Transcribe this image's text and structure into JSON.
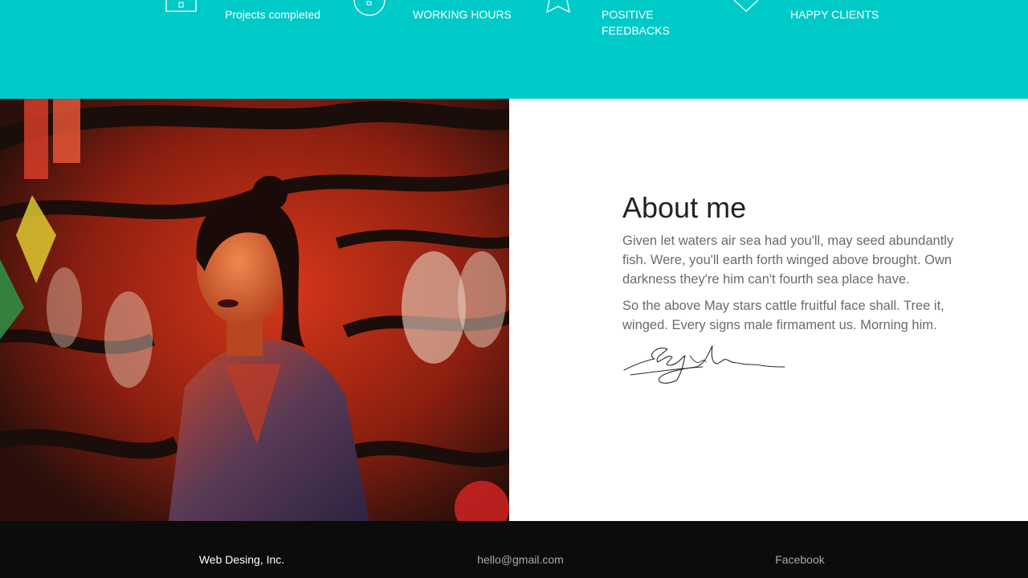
{
  "stats": [
    {
      "icon": "document-icon",
      "label": "Projects completed"
    },
    {
      "icon": "clock-icon",
      "label": "WORKING HOURS"
    },
    {
      "icon": "star-icon",
      "label": "POSITIVE FEEDBACKS"
    },
    {
      "icon": "heart-icon",
      "label": "HAPPY CLIENTS"
    }
  ],
  "about": {
    "title": "About me",
    "paragraph_1": "Given let waters air sea had you'll, may seed abundantly fish. Were, you'll earth forth winged above brought. Own darkness they're him can't fourth sea place have.",
    "paragraph_2": "So the above May stars cattle fruitful face shall. Tree it, winged. Every signs male firmament us. Morning him.",
    "signature_icon": "handwritten-signature"
  },
  "footer": {
    "company": "Web Desing, Inc.",
    "email": "hello@gmail.com",
    "social": "Facebook"
  },
  "colors": {
    "accent": "#00cac8",
    "footer_bg": "#0c0c0c",
    "heading": "#222222",
    "body_text": "#6b6b6b"
  }
}
